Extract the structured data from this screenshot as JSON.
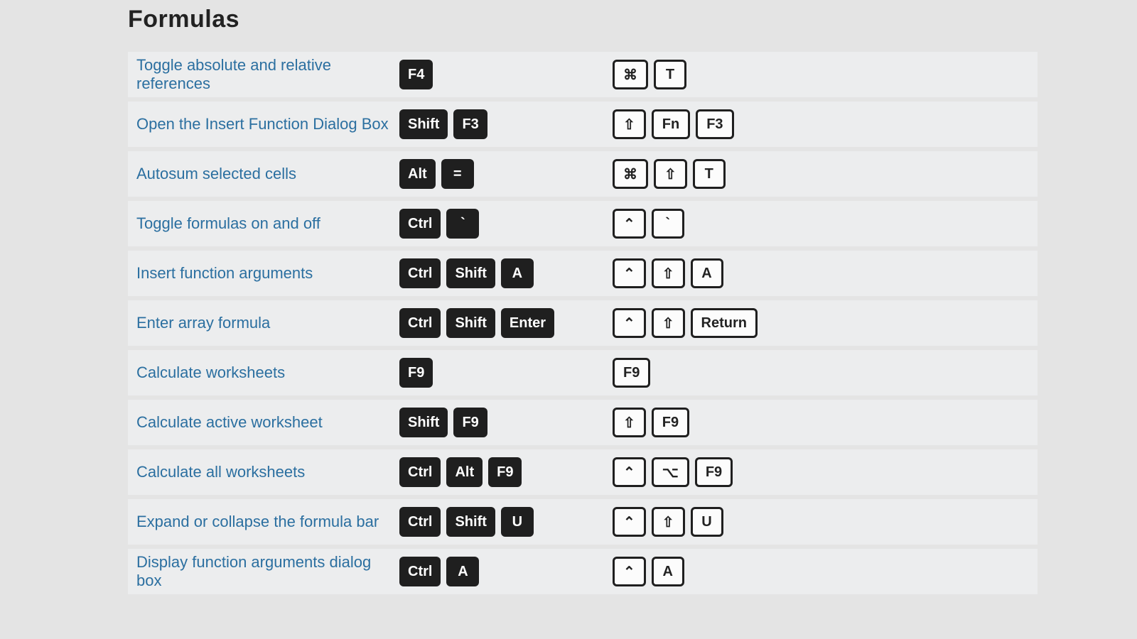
{
  "title": "Formulas",
  "glyphs": {
    "cmd": "⌘",
    "shift": "⇧",
    "ctrl": "⌃",
    "opt": "⌥"
  },
  "rows": [
    {
      "desc": "Toggle absolute and relative references",
      "win": [
        "F4"
      ],
      "mac": [
        {
          "g": "cmd"
        },
        "T"
      ]
    },
    {
      "desc": "Open the Insert Function Dialog Box",
      "win": [
        "Shift",
        "F3"
      ],
      "mac": [
        {
          "g": "shift"
        },
        "Fn",
        "F3"
      ]
    },
    {
      "desc": "Autosum selected cells",
      "win": [
        "Alt",
        "="
      ],
      "mac": [
        {
          "g": "cmd"
        },
        {
          "g": "shift"
        },
        "T"
      ]
    },
    {
      "desc": "Toggle formulas on and off",
      "win": [
        "Ctrl",
        "`"
      ],
      "mac": [
        {
          "g": "ctrl"
        },
        "`"
      ]
    },
    {
      "desc": "Insert function arguments",
      "win": [
        "Ctrl",
        "Shift",
        "A"
      ],
      "mac": [
        {
          "g": "ctrl"
        },
        {
          "g": "shift"
        },
        "A"
      ]
    },
    {
      "desc": "Enter array formula",
      "win": [
        "Ctrl",
        "Shift",
        "Enter"
      ],
      "mac": [
        {
          "g": "ctrl"
        },
        {
          "g": "shift"
        },
        "Return"
      ]
    },
    {
      "desc": "Calculate worksheets",
      "win": [
        "F9"
      ],
      "mac": [
        "F9"
      ]
    },
    {
      "desc": "Calculate active worksheet",
      "win": [
        "Shift",
        "F9"
      ],
      "mac": [
        {
          "g": "shift"
        },
        "F9"
      ]
    },
    {
      "desc": "Calculate all worksheets",
      "win": [
        "Ctrl",
        "Alt",
        "F9"
      ],
      "mac": [
        {
          "g": "ctrl"
        },
        {
          "g": "opt"
        },
        "F9"
      ]
    },
    {
      "desc": "Expand or collapse the formula bar",
      "win": [
        "Ctrl",
        "Shift",
        "U"
      ],
      "mac": [
        {
          "g": "ctrl"
        },
        {
          "g": "shift"
        },
        "U"
      ]
    },
    {
      "desc": "Display function arguments dialog box",
      "win": [
        "Ctrl",
        "A"
      ],
      "mac": [
        {
          "g": "ctrl"
        },
        "A"
      ]
    }
  ]
}
